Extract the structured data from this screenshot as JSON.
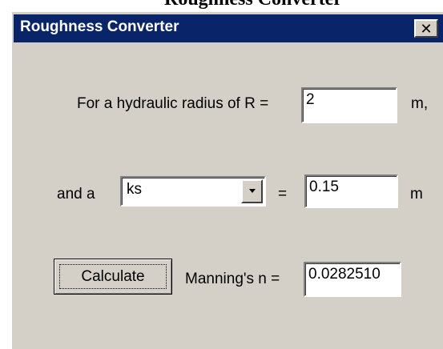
{
  "background_title": "Roughness Converter",
  "window": {
    "title": "Roughness Converter",
    "close_glyph": "✕"
  },
  "radius_row": {
    "label": "For a hydraulic radius of R =",
    "value": "2",
    "unit": "m,"
  },
  "roughness_row": {
    "prefix": "and a",
    "selected": "ks",
    "equals": "=",
    "value": "0.15",
    "unit": "m"
  },
  "result_row": {
    "button_label": "Calculate",
    "label": "Manning's n =",
    "value": "0.0282510"
  },
  "colors": {
    "face": "#d4d0c8",
    "titlebar": "#0a246a",
    "title_text": "#ffffff"
  },
  "icons": {
    "close": "close-icon",
    "dropdown": "chevron-down-icon"
  }
}
